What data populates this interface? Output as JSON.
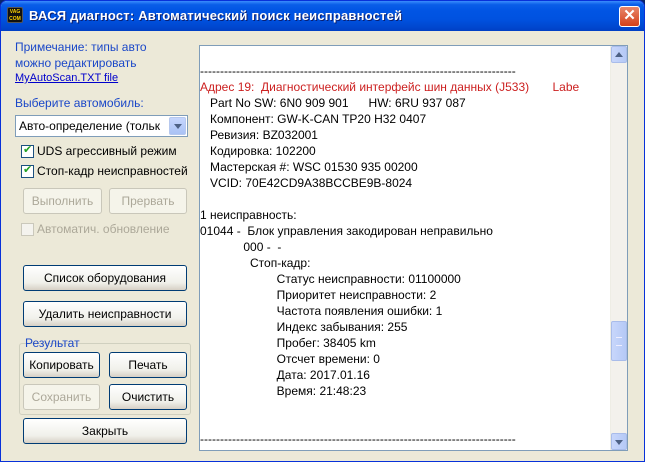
{
  "window": {
    "title": "ВАСЯ диагност:  Автоматический поиск неисправностей",
    "icon": "app-icon",
    "close_label": "✕"
  },
  "left": {
    "note_line1": "Примечание: типы авто",
    "note_line2": "можно редактировать",
    "note_link": "MyAutoScan.TXT file",
    "car_label": "Выберите автомобиль:",
    "car_select_value": "Авто-определение (тольк",
    "uds_checkbox": {
      "label": "UDS агрессивный режим",
      "checked": true
    },
    "freeze_checkbox": {
      "label": "Стоп-кадр неисправностей",
      "checked": true
    },
    "run_button": "Выполнить",
    "abort_button": "Прервать",
    "auto_update_checkbox": {
      "label": "Автоматич. обновление",
      "checked": false
    },
    "equipment_button": "Список оборудования",
    "clear_faults_button": "Удалить неисправности",
    "result_label": "Результат",
    "copy_button": "Копировать",
    "print_button": "Печать",
    "save_button": "Сохранить",
    "clear_button": "Очистить",
    "close_button": "Закрыть"
  },
  "output": {
    "lines": [
      {
        "text": "-------------------------------------------------------------------------------",
        "style": ""
      },
      {
        "text": "Адрес 19:  Диагностический интерфейс шин данных (J533)       Labe",
        "style": "red"
      },
      {
        "text": "   Part No SW: 6N0 909 901      HW: 6RU 937 087",
        "style": ""
      },
      {
        "text": "   Компонент: GW-K-CAN TP20 H32 0407",
        "style": ""
      },
      {
        "text": "   Ревизия: BZ032001",
        "style": ""
      },
      {
        "text": "   Кодировка: 102200",
        "style": ""
      },
      {
        "text": "   Мастерская #: WSC 01530 935 00200",
        "style": ""
      },
      {
        "text": "   VCID: 70E42CD9A38BCCBE9B-8024",
        "style": ""
      },
      {
        "text": "",
        "style": ""
      },
      {
        "text": "1 неисправность:",
        "style": ""
      },
      {
        "text": "01044 -  Блок управления закодирован неправильно",
        "style": ""
      },
      {
        "text": "             000 -  -",
        "style": ""
      },
      {
        "text": "               Стоп-кадр:",
        "style": ""
      },
      {
        "text": "                       Статус неисправности: 01100000",
        "style": ""
      },
      {
        "text": "                       Приоритет неисправности: 2",
        "style": ""
      },
      {
        "text": "                       Частота появления ошибки: 1",
        "style": ""
      },
      {
        "text": "                       Индекс забывания: 255",
        "style": ""
      },
      {
        "text": "                       Пробег: 38405 km",
        "style": ""
      },
      {
        "text": "                       Отсчет времени: 0",
        "style": ""
      },
      {
        "text": "                       Дата: 2017.01.16",
        "style": ""
      },
      {
        "text": "                       Время: 21:48:23",
        "style": ""
      },
      {
        "text": "",
        "style": ""
      },
      {
        "text": "",
        "style": ""
      },
      {
        "text": "-------------------------------------------------------------------------------",
        "style": ""
      }
    ]
  },
  "colors": {
    "titlebar": "#0052e0",
    "label_blue": "#1a47c8",
    "address_red": "#cc2020",
    "window_bg": "#ece9d8"
  }
}
